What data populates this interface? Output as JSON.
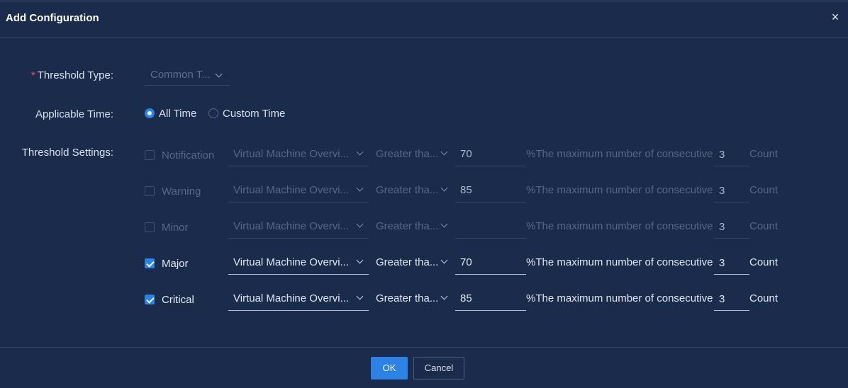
{
  "dialog": {
    "title": "Add Configuration",
    "close_symbol": "×"
  },
  "form": {
    "threshold_type": {
      "required_mark": "*",
      "label": "Threshold Type:",
      "value": "Common T..."
    },
    "applicable_time": {
      "label": "Applicable Time:",
      "options": [
        {
          "label": "All Time",
          "selected": true
        },
        {
          "label": "Custom Time",
          "selected": false
        }
      ]
    },
    "threshold_settings": {
      "label": "Threshold Settings:",
      "rows": [
        {
          "level": "Notification",
          "checked": false,
          "metric": "Virtual Machine Overvi...",
          "comparator": "Greater tha...",
          "value": "70",
          "description": "%The maximum number of consecutive",
          "consecutive": "3",
          "unit": "Count"
        },
        {
          "level": "Warning",
          "checked": false,
          "metric": "Virtual Machine Overvi...",
          "comparator": "Greater tha...",
          "value": "85",
          "description": "%The maximum number of consecutive",
          "consecutive": "3",
          "unit": "Count"
        },
        {
          "level": "Minor",
          "checked": false,
          "metric": "Virtual Machine Overvi...",
          "comparator": "Greater tha...",
          "value": "",
          "description": "%The maximum number of consecutive",
          "consecutive": "3",
          "unit": "Count"
        },
        {
          "level": "Major",
          "checked": true,
          "metric": "Virtual Machine Overvi...",
          "comparator": "Greater tha...",
          "value": "70",
          "description": "%The maximum number of consecutive",
          "consecutive": "3",
          "unit": "Count"
        },
        {
          "level": "Critical",
          "checked": true,
          "metric": "Virtual Machine Overvi...",
          "comparator": "Greater tha...",
          "value": "85",
          "description": "%The maximum number of consecutive",
          "consecutive": "3",
          "unit": "Count"
        }
      ]
    }
  },
  "footer": {
    "ok_label": "OK",
    "cancel_label": "Cancel"
  },
  "colors": {
    "background": "#1a2b4b",
    "accent": "#2d82e6",
    "required": "#ff4d63"
  }
}
